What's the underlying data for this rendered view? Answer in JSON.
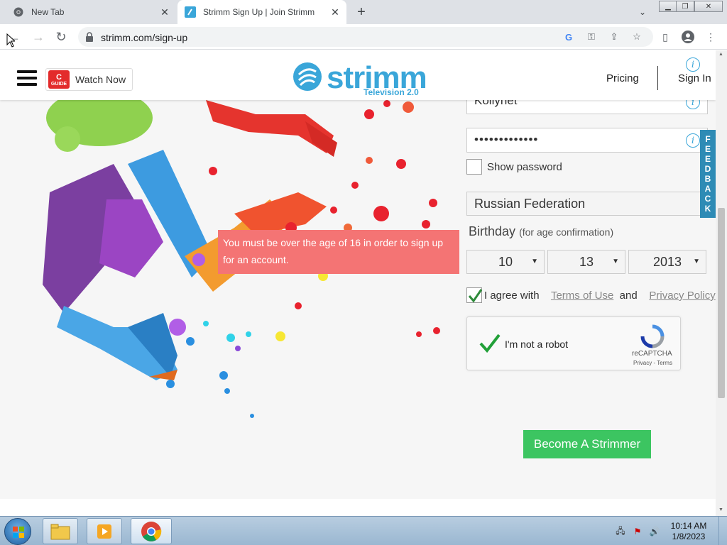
{
  "browser": {
    "tabs": [
      {
        "title": "New Tab",
        "active": false
      },
      {
        "title": "Strimm Sign Up | Join Strimm",
        "active": true
      }
    ],
    "url": "strimm.com/sign-up"
  },
  "header": {
    "watch_now": "Watch Now",
    "cguide_line1": "C",
    "cguide_line2": "GUIDE",
    "logo_word": "strimm",
    "logo_tagline": "Television 2.0",
    "pricing": "Pricing",
    "sign_in": "Sign In",
    "info_glyph": "i"
  },
  "form": {
    "username_value": "Kollynet",
    "password_value": "•••••••••••••",
    "show_password_label": "Show password",
    "country_value": "Russian Federation",
    "birthday_label": "Birthday",
    "birthday_hint": "(for age confirmation)",
    "birth_month": "10",
    "birth_day": "13",
    "birth_year": "2013",
    "agree_prefix": "I agree with",
    "terms_link": "Terms of Use",
    "and": "and",
    "privacy_link": "Privacy Policy",
    "agree_checked": true,
    "error_message": "You must be over the age of 16 in order to sign up for an account.",
    "submit": "Become A Strimmer"
  },
  "captcha": {
    "label": "I'm not a robot",
    "brand": "reCAPTCHA",
    "links": "Privacy - Terms"
  },
  "feedback_tab": [
    "F",
    "E",
    "E",
    "D",
    "B",
    "A",
    "C",
    "K"
  ],
  "taskbar": {
    "time": "10:14 AM",
    "date": "1/8/2023"
  },
  "colors": {
    "brand_blue": "#3aa6d9",
    "error_bg": "#f47474",
    "submit_green": "#3cc561",
    "feedback_blue": "#2e8bb5"
  }
}
